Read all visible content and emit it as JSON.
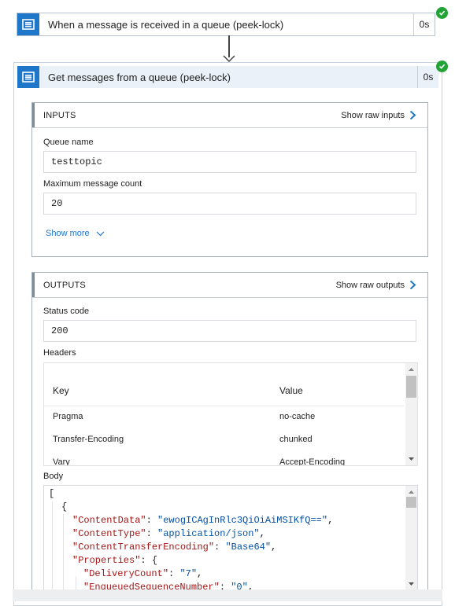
{
  "trigger": {
    "title": "When a message is received in a queue (peek-lock)",
    "duration": "0s",
    "icon": "service-bus-icon",
    "status": "succeeded"
  },
  "action": {
    "title": "Get messages from a queue (peek-lock)",
    "duration": "0s",
    "icon": "service-bus-icon",
    "status": "succeeded"
  },
  "inputs": {
    "header": "INPUTS",
    "raw_link": "Show raw inputs",
    "queue_label": "Queue name",
    "queue_value": "testtopic",
    "max_label": "Maximum message count",
    "max_value": "20",
    "show_more": "Show more"
  },
  "outputs": {
    "header": "OUTPUTS",
    "raw_link": "Show raw outputs",
    "status_label": "Status code",
    "status_value": "200",
    "headers_label": "Headers",
    "headers_table": {
      "columns": [
        "Key",
        "Value"
      ],
      "rows": [
        {
          "key": "Pragma",
          "value": "no-cache"
        },
        {
          "key": "Transfer-Encoding",
          "value": "chunked"
        },
        {
          "key": "Vary",
          "value": "Accept-Encoding"
        }
      ]
    },
    "body_label": "Body",
    "body_lines": [
      {
        "open": "["
      },
      {
        "open": "{"
      },
      {
        "key": "\"ContentData\"",
        "sep": ": ",
        "val": "\"ewogICAgInRlc3QiOiAiMSIKfQ==\"",
        "end": ","
      },
      {
        "key": "\"ContentType\"",
        "sep": ": ",
        "val": "\"application/json\"",
        "end": ","
      },
      {
        "key": "\"ContentTransferEncoding\"",
        "sep": ": ",
        "val": "\"Base64\"",
        "end": ","
      },
      {
        "key": "\"Properties\"",
        "sep": ": ",
        "val": "",
        "end": "{"
      },
      {
        "key": "\"DeliveryCount\"",
        "sep": ": ",
        "val": "\"7\"",
        "end": ","
      },
      {
        "key": "\"EnqueuedSequenceNumber\"",
        "sep": ": ",
        "val": "\"0\"",
        "end": ","
      }
    ]
  },
  "colors": {
    "accent": "#1e77c9",
    "success": "#21a336",
    "header_bg": "#eaf1f8"
  }
}
